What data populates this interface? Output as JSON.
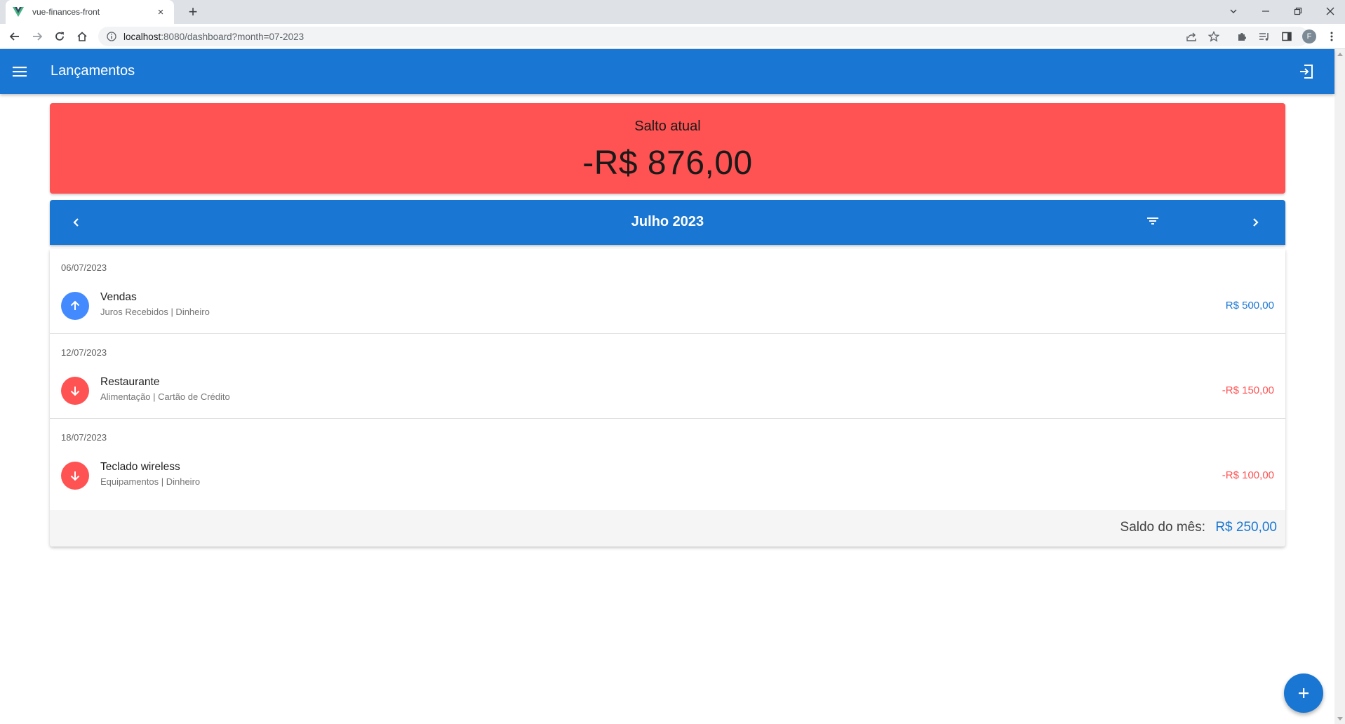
{
  "browser": {
    "tab_title": "vue-finances-front",
    "tab_close": "×",
    "new_tab": "+",
    "url_host": "localhost",
    "url_path": ":8080/dashboard?month=07-2023",
    "profile_initial": "F"
  },
  "app": {
    "title": "Lançamentos"
  },
  "balance": {
    "label": "Salto atual",
    "value": "-R$ 876,00",
    "color": "#ff5252"
  },
  "month": {
    "title": "Julho 2023"
  },
  "groups": [
    {
      "date": "06/07/2023",
      "entry": {
        "title": "Vendas",
        "subtitle": "Juros Recebidos | Dinheiro",
        "amount": "R$ 500,00",
        "direction": "up-arrow-icon"
      }
    },
    {
      "date": "12/07/2023",
      "entry": {
        "title": "Restaurante",
        "subtitle": "Alimentação | Cartão de Crédito",
        "amount": "-R$ 150,00",
        "direction": "down-arrow-icon"
      }
    },
    {
      "date": "18/07/2023",
      "entry": {
        "title": "Teclado wireless",
        "subtitle": "Equipamentos | Dinheiro",
        "amount": "-R$ 100,00",
        "direction": "down-arrow-icon"
      }
    }
  ],
  "footer": {
    "label": "Saldo do mês:",
    "value": "R$ 250,00"
  },
  "colors": {
    "primary": "#1976d2",
    "negative": "#ff5252",
    "positive_avatar": "#448aff"
  }
}
